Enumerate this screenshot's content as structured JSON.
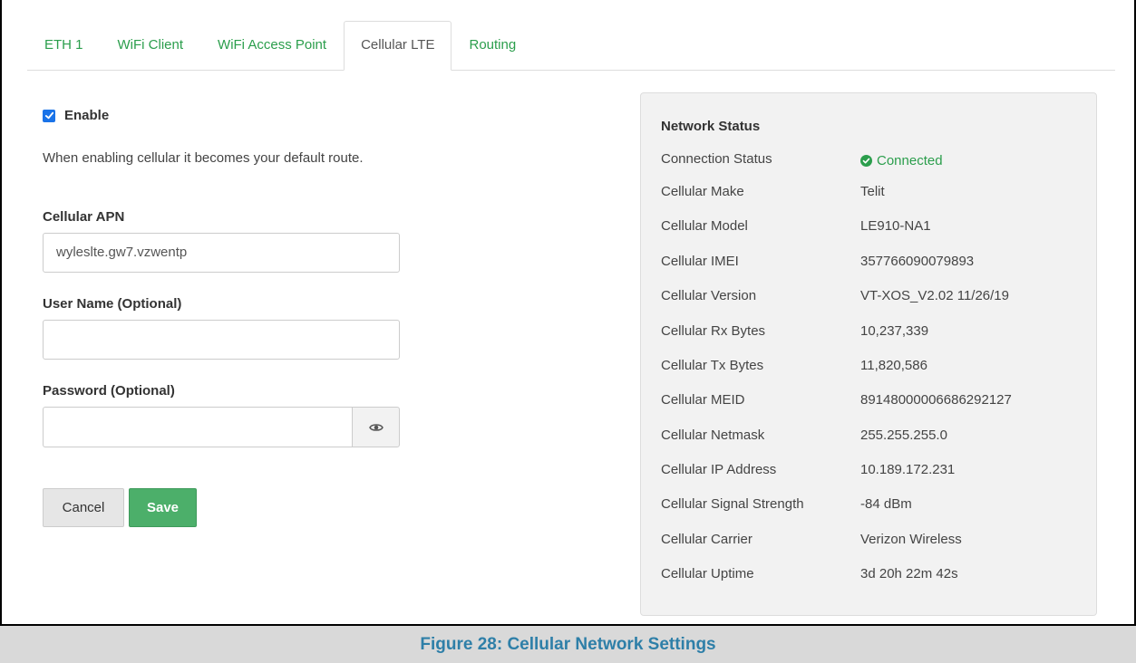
{
  "tabs": [
    {
      "label": "ETH 1",
      "active": false
    },
    {
      "label": "WiFi Client",
      "active": false
    },
    {
      "label": "WiFi Access Point",
      "active": false
    },
    {
      "label": "Cellular LTE",
      "active": true
    },
    {
      "label": "Routing",
      "active": false
    }
  ],
  "form": {
    "enable_label": "Enable",
    "enable_checked": true,
    "help_text": "When enabling cellular it becomes your default route.",
    "apn_label": "Cellular APN",
    "apn_value": "wyleslte.gw7.vzwentp",
    "username_label": "User Name (Optional)",
    "username_value": "",
    "password_label": "Password (Optional)",
    "password_value": "",
    "cancel_label": "Cancel",
    "save_label": "Save"
  },
  "network_status": {
    "title": "Network Status",
    "rows": [
      {
        "key": "Connection Status",
        "value": "Connected"
      },
      {
        "key": "Cellular Make",
        "value": "Telit"
      },
      {
        "key": "Cellular Model",
        "value": "LE910-NA1"
      },
      {
        "key": "Cellular IMEI",
        "value": "357766090079893"
      },
      {
        "key": "Cellular Version",
        "value": "VT-XOS_V2.02 11/26/19"
      },
      {
        "key": "Cellular Rx Bytes",
        "value": "10,237,339"
      },
      {
        "key": "Cellular Tx Bytes",
        "value": "11,820,586"
      },
      {
        "key": "Cellular MEID",
        "value": "89148000006686292127"
      },
      {
        "key": "Cellular Netmask",
        "value": "255.255.255.0"
      },
      {
        "key": "Cellular IP Address",
        "value": "10.189.172.231"
      },
      {
        "key": "Cellular Signal Strength",
        "value": "-84 dBm"
      },
      {
        "key": "Cellular Carrier",
        "value": "Verizon Wireless"
      },
      {
        "key": "Cellular Uptime",
        "value": "3d 20h 22m 42s"
      }
    ]
  },
  "caption": "Figure 28: Cellular Network Settings",
  "colors": {
    "accent_green": "#2b9e4c",
    "save_button": "#4caf6a",
    "checkbox_blue": "#1a73e8",
    "caption_text": "#2e7fa8"
  },
  "icons": {
    "checkbox": "check-icon",
    "password_toggle": "eye-icon",
    "connected": "check-circle-icon"
  }
}
